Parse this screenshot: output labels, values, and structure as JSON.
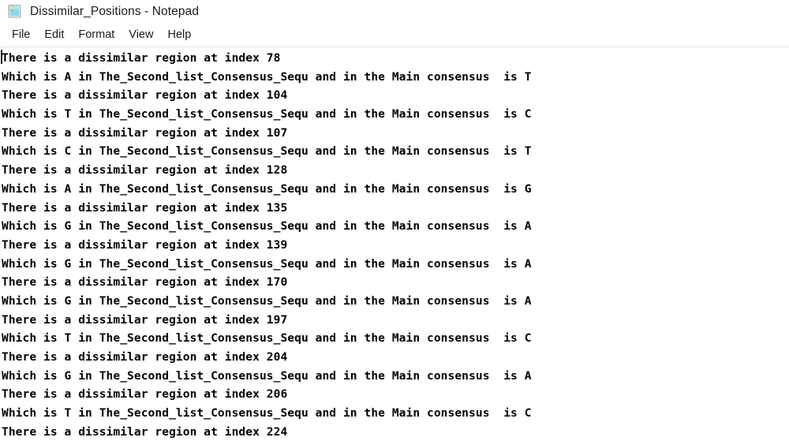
{
  "window": {
    "title": "Dissimilar_Positions - Notepad",
    "icon": "notepad-icon"
  },
  "menu": {
    "items": [
      {
        "label": "File"
      },
      {
        "label": "Edit"
      },
      {
        "label": "Format"
      },
      {
        "label": "View"
      },
      {
        "label": "Help"
      }
    ]
  },
  "document": {
    "caret_visible": true,
    "lines": [
      "There is a dissimilar region at index 78",
      "Which is A in The_Second_list_Consensus_Sequ and in the Main consensus  is T",
      "There is a dissimilar region at index 104",
      "Which is T in The_Second_list_Consensus_Sequ and in the Main consensus  is C",
      "There is a dissimilar region at index 107",
      "Which is C in The_Second_list_Consensus_Sequ and in the Main consensus  is T",
      "There is a dissimilar region at index 128",
      "Which is A in The_Second_list_Consensus_Sequ and in the Main consensus  is G",
      "There is a dissimilar region at index 135",
      "Which is G in The_Second_list_Consensus_Sequ and in the Main consensus  is A",
      "There is a dissimilar region at index 139",
      "Which is G in The_Second_list_Consensus_Sequ and in the Main consensus  is A",
      "There is a dissimilar region at index 170",
      "Which is G in The_Second_list_Consensus_Sequ and in the Main consensus  is A",
      "There is a dissimilar region at index 197",
      "Which is T in The_Second_list_Consensus_Sequ and in the Main consensus  is C",
      "There is a dissimilar region at index 204",
      "Which is G in The_Second_list_Consensus_Sequ and in the Main consensus  is A",
      "There is a dissimilar region at index 206",
      "Which is T in The_Second_list_Consensus_Sequ and in the Main consensus  is C",
      "There is a dissimilar region at index 224"
    ],
    "dissimilar_indices": [
      78,
      104,
      107,
      128,
      135,
      139,
      170,
      197,
      204,
      206,
      224
    ],
    "pairs": [
      {
        "index": 78,
        "second_list": "A",
        "main": "T"
      },
      {
        "index": 104,
        "second_list": "T",
        "main": "C"
      },
      {
        "index": 107,
        "second_list": "C",
        "main": "T"
      },
      {
        "index": 128,
        "second_list": "A",
        "main": "G"
      },
      {
        "index": 135,
        "second_list": "G",
        "main": "A"
      },
      {
        "index": 139,
        "second_list": "G",
        "main": "A"
      },
      {
        "index": 170,
        "second_list": "G",
        "main": "A"
      },
      {
        "index": 197,
        "second_list": "T",
        "main": "C"
      },
      {
        "index": 204,
        "second_list": "G",
        "main": "A"
      },
      {
        "index": 206,
        "second_list": "T",
        "main": "C"
      }
    ]
  },
  "colors": {
    "window_bg": "#ffffff",
    "text": "#000000",
    "title_text": "#1b1b1b",
    "separator": "#e6e6e6",
    "icon_blue": "#7fd3e8"
  }
}
